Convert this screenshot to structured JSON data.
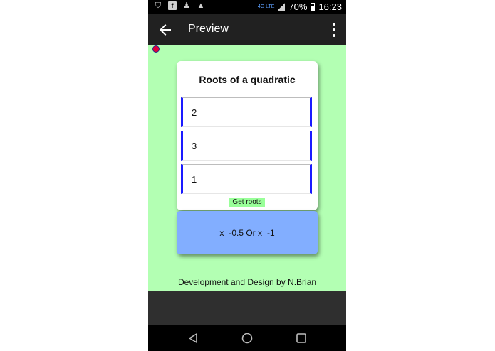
{
  "status_bar": {
    "network": "4G LTE",
    "battery": "70%",
    "time": "16:23",
    "icons": [
      "shield-icon",
      "facebook-icon",
      "app-notification-icon",
      "warning-icon"
    ]
  },
  "app_bar": {
    "title": "Preview",
    "back_icon": "arrow-left-icon",
    "menu_icon": "more-vert-icon"
  },
  "card": {
    "title": "Roots of a quadratic",
    "inputs": [
      {
        "value": "2"
      },
      {
        "value": "3"
      },
      {
        "value": "1"
      }
    ],
    "button_label": "Get roots"
  },
  "result": {
    "text": "x=-0.5 Or x=-1"
  },
  "footer": {
    "text": "Development and Design by N.Brian"
  },
  "nav_bar": {
    "buttons": [
      "back-triangle-icon",
      "home-circle-icon",
      "recents-square-icon"
    ]
  },
  "colors": {
    "background": "#b3ffb3",
    "accent_border": "#1a1aff",
    "button": "#99ff99",
    "result_panel": "#82aeff",
    "app_bar": "#212121"
  }
}
